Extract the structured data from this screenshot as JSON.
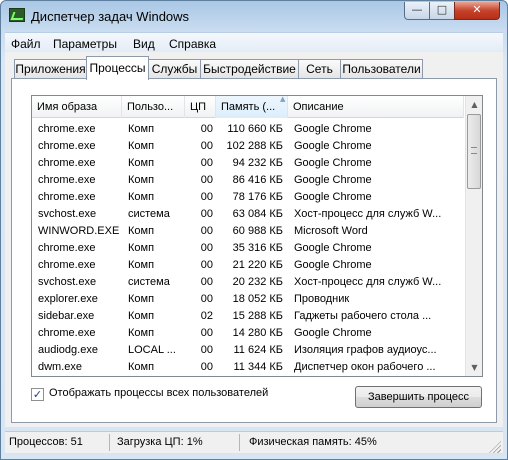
{
  "window": {
    "title": "Диспетчер задач Windows",
    "close_glyph": "✕",
    "min_glyph": "—",
    "max_glyph": "□"
  },
  "menu": [
    "Файл",
    "Параметры",
    "Вид",
    "Справка"
  ],
  "tabs": [
    "Приложения",
    "Процессы",
    "Службы",
    "Быстродействие",
    "Сеть",
    "Пользователи"
  ],
  "active_tab": "Процессы",
  "columns": {
    "name": "Имя образа",
    "user": "Пользо...",
    "cpu": "ЦП",
    "memory": "Память (...",
    "description": "Описание"
  },
  "sort_indicator": "▲",
  "processes": [
    {
      "name": "chrome.exe",
      "user": "Комп",
      "cpu": "00",
      "memory": "110 660 КБ",
      "description": "Google Chrome"
    },
    {
      "name": "chrome.exe",
      "user": "Комп",
      "cpu": "00",
      "memory": "102 288 КБ",
      "description": "Google Chrome"
    },
    {
      "name": "chrome.exe",
      "user": "Комп",
      "cpu": "00",
      "memory": "94 232 КБ",
      "description": "Google Chrome"
    },
    {
      "name": "chrome.exe",
      "user": "Комп",
      "cpu": "00",
      "memory": "86 416 КБ",
      "description": "Google Chrome"
    },
    {
      "name": "chrome.exe",
      "user": "Комп",
      "cpu": "00",
      "memory": "78 176 КБ",
      "description": "Google Chrome"
    },
    {
      "name": "svchost.exe",
      "user": "система",
      "cpu": "00",
      "memory": "63 084 КБ",
      "description": "Хост-процесс для служб W..."
    },
    {
      "name": "WINWORD.EXE",
      "user": "Комп",
      "cpu": "00",
      "memory": "60 988 КБ",
      "description": "Microsoft Word"
    },
    {
      "name": "chrome.exe",
      "user": "Комп",
      "cpu": "00",
      "memory": "35 316 КБ",
      "description": "Google Chrome"
    },
    {
      "name": "chrome.exe",
      "user": "Комп",
      "cpu": "00",
      "memory": "21 220 КБ",
      "description": "Google Chrome"
    },
    {
      "name": "svchost.exe",
      "user": "система",
      "cpu": "00",
      "memory": "20 232 КБ",
      "description": "Хост-процесс для служб W..."
    },
    {
      "name": "explorer.exe",
      "user": "Комп",
      "cpu": "00",
      "memory": "18 052 КБ",
      "description": "Проводник"
    },
    {
      "name": "sidebar.exe",
      "user": "Комп",
      "cpu": "02",
      "memory": "15 288 КБ",
      "description": "Гаджеты рабочего стола ..."
    },
    {
      "name": "chrome.exe",
      "user": "Комп",
      "cpu": "00",
      "memory": "14 280 КБ",
      "description": "Google Chrome"
    },
    {
      "name": "audiodg.exe",
      "user": "LOCAL ...",
      "cpu": "00",
      "memory": "11 624 КБ",
      "description": "Изоляция графов аудиоус..."
    },
    {
      "name": "dwm.exe",
      "user": "Комп",
      "cpu": "00",
      "memory": "11 344 КБ",
      "description": "Диспетчер окон рабочего ..."
    }
  ],
  "scrollbar": {
    "up_glyph": "▲",
    "down_glyph": "▼"
  },
  "show_all_checkbox": {
    "checked": true,
    "glyph": "✓",
    "label": "Отображать процессы всех пользователей"
  },
  "end_process_label": "Завершить процесс",
  "status": {
    "processes": "Процессов: 51",
    "cpu": "Загрузка ЦП: 1%",
    "memory": "Физическая память: 45%"
  }
}
